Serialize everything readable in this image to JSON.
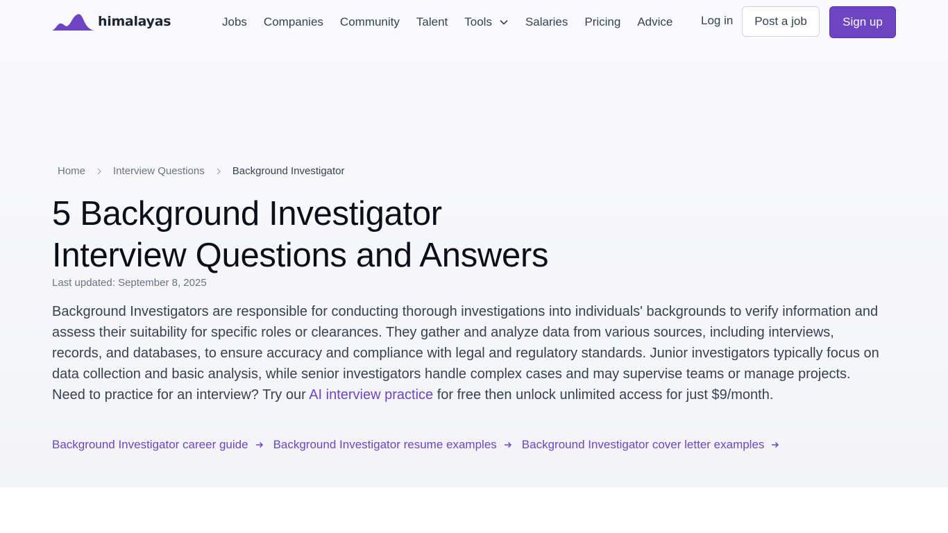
{
  "brand": {
    "name": "himalayas",
    "color": "#6d45c2"
  },
  "nav": {
    "items": [
      "Jobs",
      "Companies",
      "Community",
      "Talent",
      "Tools",
      "Salaries",
      "Pricing",
      "Advice"
    ],
    "login": "Log in",
    "post_job": "Post a job",
    "sign_up": "Sign up"
  },
  "breadcrumb": [
    "Home",
    "Interview Questions",
    "Background Investigator"
  ],
  "page": {
    "title_line1": "5 Background Investigator",
    "title_line2": "Interview Questions and Answers",
    "updated": "Last updated: September 8, 2025",
    "desc_before": "Background Investigators are responsible for conducting thorough investigations into individuals' backgrounds to verify information and assess their suitability for specific roles or clearances. They gather and analyze data from various sources, including interviews, records, and databases, to ensure accuracy and compliance with legal and regulatory standards. Junior investigators typically focus on data collection and basic analysis, while senior investigators handle complex cases and may supervise teams or manage projects. Need to practice for an interview? Try our ",
    "desc_link": "AI interview practice",
    "desc_after": " for free then unlock unlimited access for just $9/month."
  },
  "related_links": [
    "Background Investigator career guide",
    "Background Investigator resume examples",
    "Background Investigator cover letter examples"
  ]
}
